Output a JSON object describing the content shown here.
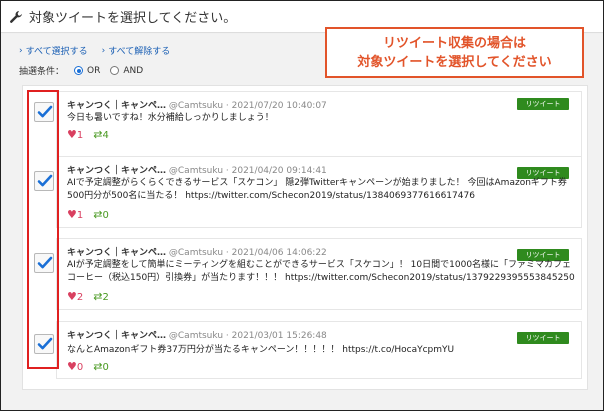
{
  "header": {
    "title": "対象ツイートを選択してください。"
  },
  "links": {
    "select_all": "すべて選択する",
    "deselect_all": "すべて解除する"
  },
  "condition": {
    "label": "抽選条件：",
    "or_label": "OR",
    "and_label": "AND",
    "selected": "OR"
  },
  "callout": {
    "line1": "リツイート収集の場合は",
    "line2": "対象ツイートを選択してください"
  },
  "tweets": [
    {
      "name": "キャンつく｜キャンペ…",
      "handle": "@Camtsuku",
      "date": "· 2021/07/20 10:40:07",
      "text": "今日も暑いですね！水分補給しっかりしましょう！",
      "likes": "1",
      "retweets": "4",
      "badge": "リツイート",
      "checked": true
    },
    {
      "name": "キャンつく｜キャンペ…",
      "handle": "@Camtsuku",
      "date": "· 2021/04/20 09:14:41",
      "text": "AIで予定調整がらくらくできるサービス「スケコン」 隠2弾Twitterキャンペーンが始まりました！ 今回はAmazonギフト券500円分が500名に当たる！ https://twitter.com/Schecon2019/status/1384069377616617476",
      "likes": "1",
      "retweets": "0",
      "badge": "リツイート",
      "checked": true
    },
    {
      "name": "キャンつく｜キャンペ…",
      "handle": "@Camtsuku",
      "date": "· 2021/04/06 14:06:22",
      "text": "AIが予定調整をして簡単にミーティングを組むことができるサービス「スケコン」！ 10日間で1000名様に「ファミマカフェコーヒー（税込150円）引換券」が当たります！！！ https://twitter.com/Schecon2019/status/1379229395553845250",
      "likes": "2",
      "retweets": "2",
      "badge": "リツイート",
      "checked": true
    },
    {
      "name": "キャンつく｜キャンペ…",
      "handle": "@Camtsuku",
      "date": "· 2021/03/01 15:26:48",
      "text": "なんとAmazonギフト券37万円分が当たるキャンペーン！！！！！ https://t.co/HocaYcpmYU",
      "likes": "0",
      "retweets": "0",
      "badge": "リツイート",
      "checked": true
    }
  ],
  "colors": {
    "accent_red": "#e2542a",
    "badge_green": "#2f8a1e",
    "link_blue": "#1a5fb4",
    "check_blue": "#1a6fd6"
  }
}
